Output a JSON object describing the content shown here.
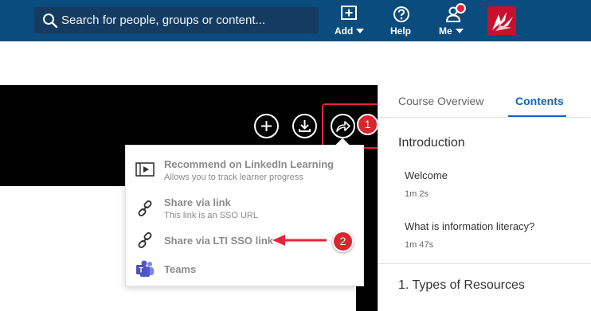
{
  "header": {
    "search_placeholder": "Search for people, groups or content...",
    "nav": [
      {
        "label": "Add",
        "icon": "add-box-icon",
        "has_menu": true
      },
      {
        "label": "Help",
        "icon": "help-icon",
        "has_menu": false
      },
      {
        "label": "Me",
        "icon": "person-icon",
        "has_menu": true,
        "notification": true
      }
    ],
    "logo": "brand-logo",
    "colors": {
      "bar": "#0a4c7d",
      "search_bg": "#153c60",
      "notification": "#e8233a",
      "logo": "#c8102e"
    }
  },
  "video_toolbar": {
    "buttons": [
      "add-icon",
      "download-icon",
      "share-icon"
    ]
  },
  "share_menu": {
    "items": [
      {
        "title": "Recommend on LinkedIn Learning",
        "subtitle": "Allows you to track learner progress",
        "icon": "video-icon"
      },
      {
        "title": "Share via link",
        "subtitle": "This link is an SSO URL",
        "icon": "link-icon"
      },
      {
        "title": "Share via LTI SSO link",
        "subtitle": "",
        "icon": "link-icon"
      },
      {
        "title": "Teams",
        "subtitle": "",
        "icon": "teams-icon"
      }
    ]
  },
  "annotations": {
    "badge_1": "1",
    "badge_2": "2",
    "color": "#e8233a"
  },
  "panel": {
    "tabs": [
      {
        "label": "Course Overview",
        "active": false
      },
      {
        "label": "Contents",
        "active": true
      }
    ],
    "sections": [
      {
        "title": "Introduction",
        "lessons": [
          {
            "title": "Welcome",
            "duration": "1m 2s"
          },
          {
            "title": "What is information literacy?",
            "duration": "1m 47s"
          }
        ]
      },
      {
        "title": "1. Types of Resources",
        "lessons": []
      }
    ],
    "accent": "#0a66c2"
  }
}
